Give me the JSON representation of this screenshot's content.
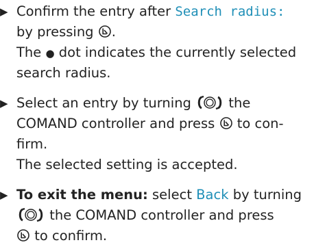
{
  "steps": [
    {
      "bullet": "▶",
      "lines": [
        {
          "prefix": "Confirm the entry after ",
          "menu_value": "Search radius:"
        },
        {
          "prefix": "by pressing ",
          "suffix": "."
        },
        {
          "text_a": "The ",
          "dot": "●",
          "text_b": " dot indicates the currently selected"
        },
        {
          "text": "search radius."
        }
      ]
    },
    {
      "bullet": "▶",
      "lines": [
        {
          "prefix": "Select an entry by turning ",
          "suffix": " the"
        },
        {
          "prefix": "COMAND controller and press ",
          "suffix": " to con-"
        },
        {
          "text": "firm."
        },
        {
          "text": "The selected setting is accepted."
        }
      ]
    },
    {
      "bullet": "▶",
      "lines": [
        {
          "bold": "To exit the menu:",
          "mid": " select ",
          "menu_value": "Back",
          "suffix": " by turning"
        },
        {
          "suffix": " the COMAND controller and press"
        },
        {
          "suffix": " to confirm."
        }
      ]
    }
  ],
  "icons": {
    "press": "press-controller-icon",
    "turn": "turn-controller-icon"
  },
  "colors": {
    "text": "#222222",
    "menu_value": "#1f8fb7"
  }
}
